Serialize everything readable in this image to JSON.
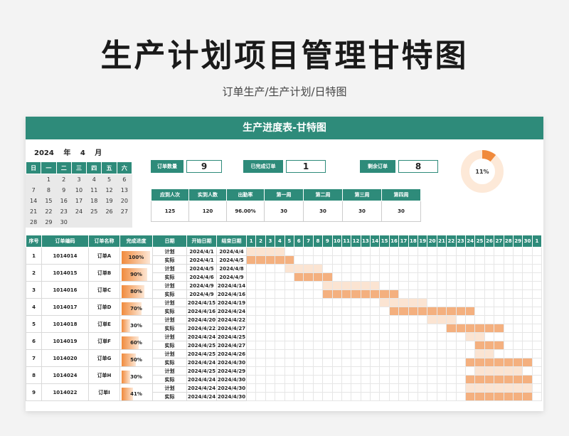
{
  "title": "生产计划项目管理甘特图",
  "subtitle": "订单生产/生产计划/日特图",
  "banner": "生产进度表-甘特图",
  "year": "2024",
  "year_unit": "年",
  "month": "4",
  "month_unit": "月",
  "calendar": {
    "weekdays": [
      "日",
      "一",
      "二",
      "三",
      "四",
      "五",
      "六"
    ],
    "weeks": [
      [
        "",
        "1",
        "2",
        "3",
        "4",
        "5",
        "6"
      ],
      [
        "7",
        "8",
        "9",
        "10",
        "11",
        "12",
        "13"
      ],
      [
        "14",
        "15",
        "16",
        "17",
        "18",
        "19",
        "20"
      ],
      [
        "21",
        "22",
        "23",
        "24",
        "25",
        "26",
        "27"
      ],
      [
        "28",
        "29",
        "30",
        "",
        "",
        "",
        ""
      ]
    ]
  },
  "kpis": {
    "orders": {
      "label": "订单数量",
      "value": "9"
    },
    "done": {
      "label": "已完成订单",
      "value": "1"
    },
    "remaining": {
      "label": "剩余订单",
      "value": "8"
    }
  },
  "stats": {
    "headers": [
      "应到人次",
      "实到人数",
      "出勤率",
      "第一周",
      "第二周",
      "第三周",
      "第四周"
    ],
    "values": [
      "125",
      "120",
      "96.00%",
      "30",
      "30",
      "30",
      "30"
    ]
  },
  "donut": {
    "label": "11%",
    "fraction": 0.11,
    "color": "#f08a3c",
    "track": "#fde9d8"
  },
  "gantt": {
    "headers": [
      "序号",
      "订单编码",
      "订单名称",
      "完成进度",
      "日期",
      "开始日期",
      "结束日期"
    ],
    "days": [
      "1",
      "2",
      "3",
      "4",
      "5",
      "6",
      "7",
      "8",
      "9",
      "10",
      "11",
      "12",
      "13",
      "14",
      "15",
      "16",
      "17",
      "18",
      "19",
      "20",
      "21",
      "22",
      "23",
      "24",
      "25",
      "26",
      "27",
      "28",
      "29",
      "30",
      "1"
    ],
    "orders": [
      {
        "no": "1",
        "code": "1014014",
        "name": "订单A",
        "progress": "100%",
        "pct": 1.0,
        "plan": {
          "label": "计划",
          "start": "2024/4/1",
          "end": "2024/4/4",
          "from": 1,
          "to": 4
        },
        "actual": {
          "label": "实际",
          "start": "2024/4/1",
          "end": "2024/4/5",
          "from": 1,
          "to": 5
        }
      },
      {
        "no": "2",
        "code": "1014015",
        "name": "订单B",
        "progress": "90%",
        "pct": 0.9,
        "plan": {
          "label": "计划",
          "start": "2024/4/5",
          "end": "2024/4/8",
          "from": 5,
          "to": 8
        },
        "actual": {
          "label": "实际",
          "start": "2024/4/6",
          "end": "2024/4/9",
          "from": 6,
          "to": 9
        }
      },
      {
        "no": "3",
        "code": "1014016",
        "name": "订单C",
        "progress": "80%",
        "pct": 0.8,
        "plan": {
          "label": "计划",
          "start": "2024/4/9",
          "end": "2024/4/14",
          "from": 9,
          "to": 14
        },
        "actual": {
          "label": "实际",
          "start": "2024/4/9",
          "end": "2024/4/16",
          "from": 9,
          "to": 16
        }
      },
      {
        "no": "4",
        "code": "1014017",
        "name": "订单D",
        "progress": "70%",
        "pct": 0.7,
        "plan": {
          "label": "计划",
          "start": "2024/4/15",
          "end": "2024/4/19",
          "from": 15,
          "to": 19
        },
        "actual": {
          "label": "实际",
          "start": "2024/4/16",
          "end": "2024/4/24",
          "from": 16,
          "to": 24
        }
      },
      {
        "no": "5",
        "code": "1014018",
        "name": "订单E",
        "progress": "30%",
        "pct": 0.3,
        "plan": {
          "label": "计划",
          "start": "2024/4/20",
          "end": "2024/4/22",
          "from": 20,
          "to": 22
        },
        "actual": {
          "label": "实际",
          "start": "2024/4/22",
          "end": "2024/4/27",
          "from": 22,
          "to": 27
        }
      },
      {
        "no": "6",
        "code": "1014019",
        "name": "订单F",
        "progress": "60%",
        "pct": 0.6,
        "plan": {
          "label": "计划",
          "start": "2024/4/24",
          "end": "2024/4/25",
          "from": 24,
          "to": 25
        },
        "actual": {
          "label": "实际",
          "start": "2024/4/25",
          "end": "2024/4/27",
          "from": 25,
          "to": 27
        }
      },
      {
        "no": "7",
        "code": "1014020",
        "name": "订单G",
        "progress": "50%",
        "pct": 0.5,
        "plan": {
          "label": "计划",
          "start": "2024/4/25",
          "end": "2024/4/26",
          "from": 25,
          "to": 26
        },
        "actual": {
          "label": "实际",
          "start": "2024/4/24",
          "end": "2024/4/30",
          "from": 24,
          "to": 30
        }
      },
      {
        "no": "8",
        "code": "1014024",
        "name": "订单H",
        "progress": "30%",
        "pct": 0.3,
        "plan": {
          "label": "计划",
          "start": "2024/4/25",
          "end": "2024/4/29",
          "from": 25,
          "to": 29
        },
        "actual": {
          "label": "实际",
          "start": "2024/4/24",
          "end": "2024/4/30",
          "from": 24,
          "to": 30
        }
      },
      {
        "no": "9",
        "code": "1014022",
        "name": "订单I",
        "progress": "41%",
        "pct": 0.41,
        "plan": {
          "label": "计划",
          "start": "2024/4/24",
          "end": "2024/4/30",
          "from": 24,
          "to": 30
        },
        "actual": {
          "label": "实际",
          "start": "2024/4/24",
          "end": "2024/4/30",
          "from": 24,
          "to": 30
        }
      }
    ]
  },
  "colors": {
    "header": "#2e8b7a",
    "plan": "#fbe4d2",
    "actual": "#f4b07f",
    "progress": "#f08a3c"
  }
}
